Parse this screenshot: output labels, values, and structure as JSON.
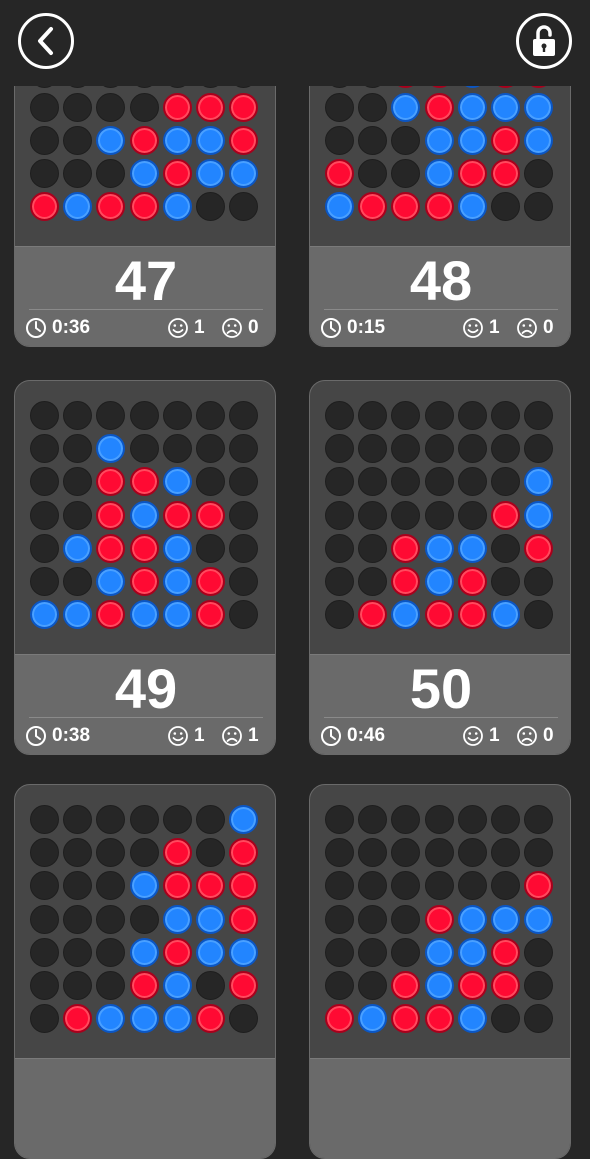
{
  "header": {
    "back_icon": "chevron-left-icon",
    "lock_icon": "unlocked-padlock-icon"
  },
  "colors": {
    "red": "#ff0a33",
    "blue": "#2285ff",
    "empty": "#262626",
    "background": "#262626"
  },
  "cards": [
    {
      "number": "47",
      "time": "0:36",
      "wins": "1",
      "losses": "0",
      "board": [
        ".......",
        ".......",
        "....RRR",
        "..BRBBR",
        "...BRBB",
        "RBRRB.."
      ]
    },
    {
      "number": "48",
      "time": "0:15",
      "wins": "1",
      "losses": "0",
      "board": [
        ".......",
        "..RRBRR",
        "..BRBBB",
        "...BBRB",
        "R..BRR.",
        "BRRRB.."
      ]
    },
    {
      "number": "49",
      "time": "0:38",
      "wins": "1",
      "losses": "1",
      "board": [
        ".......",
        "..B....",
        "..RRB..",
        "..RBRR.",
        ".BRRB..",
        "..BRBR.",
        "BBRBBR."
      ]
    },
    {
      "number": "50",
      "time": "0:46",
      "wins": "1",
      "losses": "0",
      "board": [
        ".......",
        ".......",
        "......B",
        ".....RB",
        "..RBB.R",
        "..RBR..",
        ".RBRRB."
      ]
    },
    {
      "number": "",
      "time": "",
      "wins": "",
      "losses": "",
      "board": [
        "......B",
        "....R.R",
        "...BRRR",
        "....BBR",
        "...BRBB",
        "...RB.R",
        ".RBBBR."
      ]
    },
    {
      "number": "",
      "time": "",
      "wins": "",
      "losses": "",
      "board": [
        ".......",
        ".......",
        "......R",
        "...RBBB",
        "...BBR.",
        "..RBRR.",
        "RBRRB.."
      ]
    }
  ]
}
